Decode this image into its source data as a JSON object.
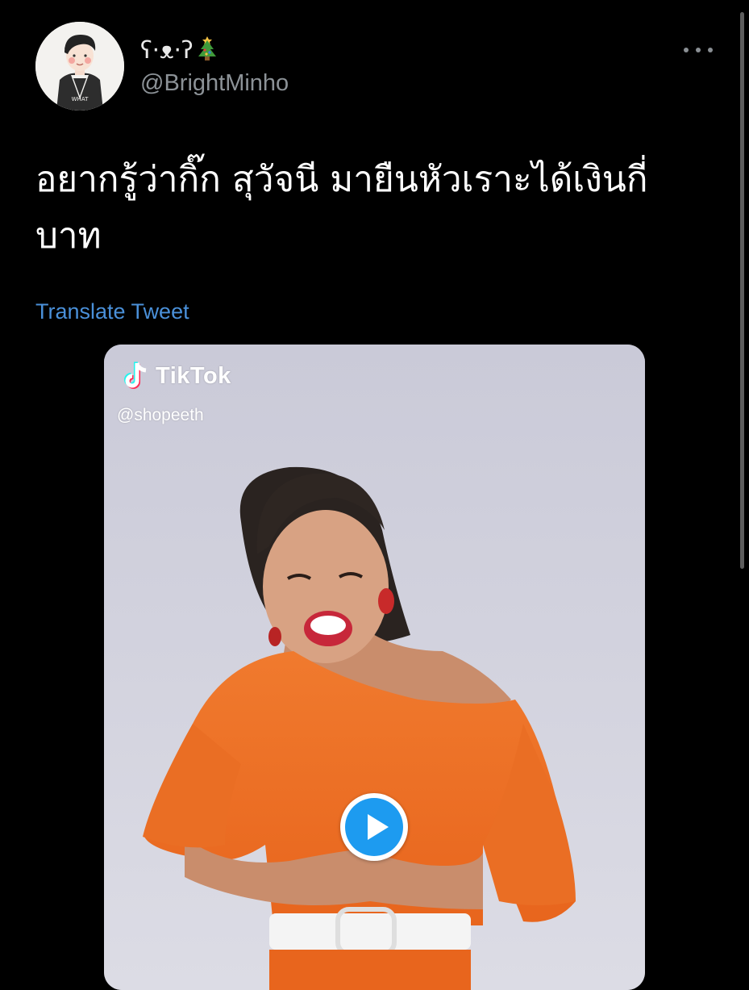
{
  "author": {
    "display_name": "ʕ·ᴥ·ʔ",
    "handle": "@BrightMinho",
    "avatar_icon": "avatar-portrait-icon",
    "name_emoji_icon": "christmas-tree-icon"
  },
  "tweet": {
    "text": "อยากรู้ว่ากิ๊ก สุวัจนี มายืนหัวเราะได้เงินกี่บาท",
    "translate_label": "Translate Tweet"
  },
  "media": {
    "watermark_brand": "TikTok",
    "watermark_user": "@shopeeth",
    "play_icon": "play-icon"
  },
  "colors": {
    "background": "#000000",
    "link": "#4a90d9",
    "play_accent": "#1d9bf0",
    "handle_gray": "#8c9297"
  }
}
